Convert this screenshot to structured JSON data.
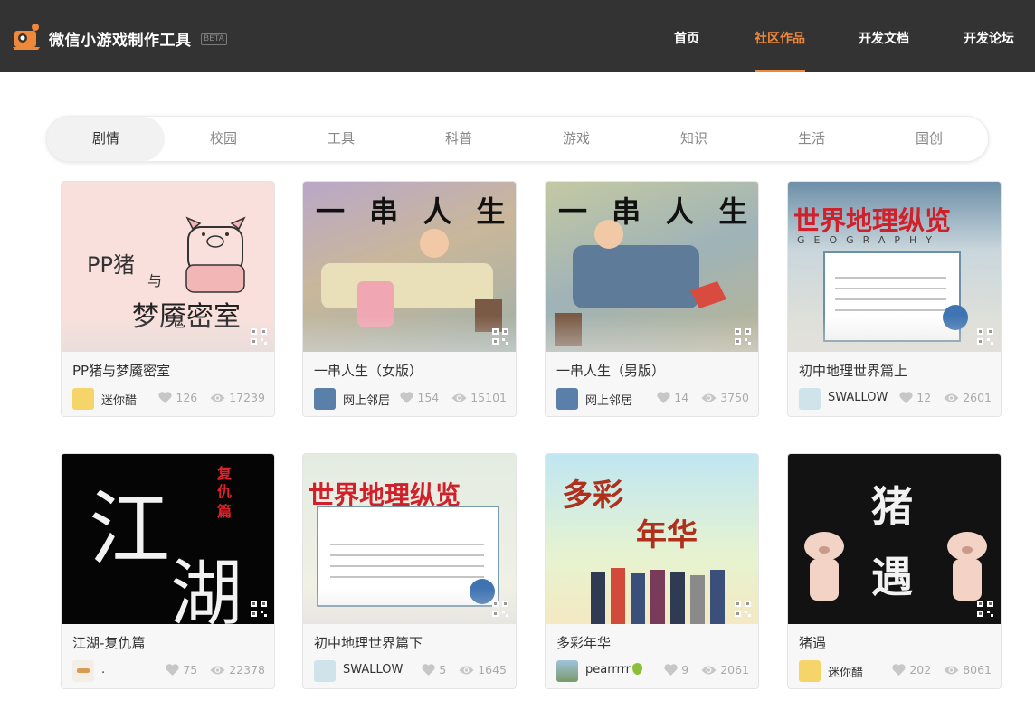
{
  "header": {
    "brand": "微信小游戏制作工具",
    "beta": "BETA",
    "nav": [
      {
        "label": "首页",
        "active": false
      },
      {
        "label": "社区作品",
        "active": true
      },
      {
        "label": "开发文档",
        "active": false
      },
      {
        "label": "开发论坛",
        "active": false
      }
    ]
  },
  "tabs": [
    {
      "label": "剧情",
      "active": true
    },
    {
      "label": "校园",
      "active": false
    },
    {
      "label": "工具",
      "active": false
    },
    {
      "label": "科普",
      "active": false
    },
    {
      "label": "游戏",
      "active": false
    },
    {
      "label": "知识",
      "active": false
    },
    {
      "label": "生活",
      "active": false
    },
    {
      "label": "国创",
      "active": false
    }
  ],
  "cards": [
    {
      "title": "PP猪与梦魇密室",
      "author": "迷你醋",
      "likes": "126",
      "views": "17239",
      "thumb_text": [
        "PP猪",
        "与",
        "梦魇密室"
      ]
    },
    {
      "title": "一串人生（女版）",
      "author": "网上邻居",
      "likes": "154",
      "views": "15101",
      "thumb_text": [
        "一 串 人 生"
      ]
    },
    {
      "title": "一串人生（男版）",
      "author": "网上邻居",
      "likes": "14",
      "views": "3750",
      "thumb_text": [
        "一 串 人 生"
      ]
    },
    {
      "title": "初中地理世界篇上",
      "author": "SWALLOW",
      "likes": "12",
      "views": "2601",
      "thumb_text": [
        "世界地理纵览",
        "GEOGRAPHY"
      ]
    },
    {
      "title": "江湖-复仇篇",
      "author": ".",
      "likes": "75",
      "views": "22378",
      "thumb_text": [
        "江",
        "湖",
        "复",
        "仇",
        "篇"
      ]
    },
    {
      "title": "初中地理世界篇下",
      "author": "SWALLOW",
      "likes": "5",
      "views": "1645",
      "thumb_text": [
        "世界地理纵览"
      ]
    },
    {
      "title": "多彩年华",
      "author": "pearrrrr",
      "likes": "9",
      "views": "2061",
      "thumb_text": [
        "多彩",
        "年华"
      ]
    },
    {
      "title": "猪遇",
      "author": "迷你醋",
      "likes": "202",
      "views": "8061",
      "thumb_text": [
        "猪",
        "遇"
      ]
    }
  ],
  "colors": {
    "header_bg": "#333333",
    "accent": "#f0883a"
  }
}
